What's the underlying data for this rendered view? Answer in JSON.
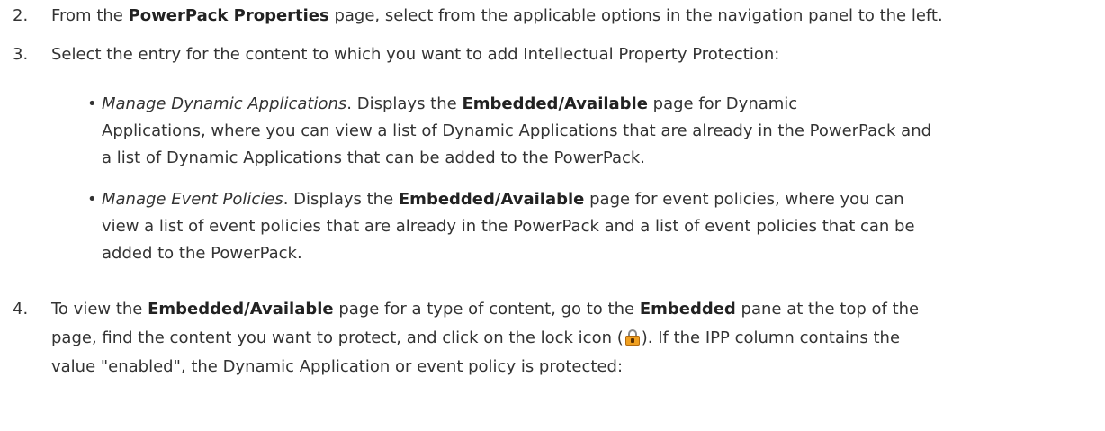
{
  "steps": [
    {
      "number": "2.",
      "prefix": "From the ",
      "bold": "PowerPack Properties",
      "suffix": " page, select from the applicable options in the navigation panel to the left."
    },
    {
      "number": "3.",
      "text": "Select the entry for the content to which you want to add Intellectual Property Protection:"
    }
  ],
  "bullets": [
    {
      "symbol": "•",
      "italic": "Manage Dynamic Applications",
      "mid": ". Displays the ",
      "bold": "Embedded/Available",
      "line1_rest": " page for Dynamic",
      "line2": "Applications, where you can view a list of Dynamic Applications that are already in the PowerPack and",
      "line3": "a list of Dynamic Applications that can be added to the PowerPack."
    },
    {
      "symbol": "•",
      "italic": "Manage Event Policies",
      "mid": ". Displays the ",
      "bold": "Embedded/Available",
      "line1_rest": " page for event policies, where you can",
      "line2": "view a list of event policies that are already in the PowerPack and a list of event policies that can be",
      "line3": "added to the PowerPack."
    }
  ],
  "step4": {
    "number": "4.",
    "a": "To view the ",
    "b1": "Embedded/Available",
    "c": " page for a type of content, go to the ",
    "b2": "Embedded",
    "d": " pane at the top of the",
    "e": "page, find the content you want to protect, and click on the lock icon (",
    "f": "). If the IPP column contains the",
    "g": "value \"enabled\", the Dynamic Application or event policy is protected:"
  },
  "icons": {
    "lock": "lock-icon"
  }
}
